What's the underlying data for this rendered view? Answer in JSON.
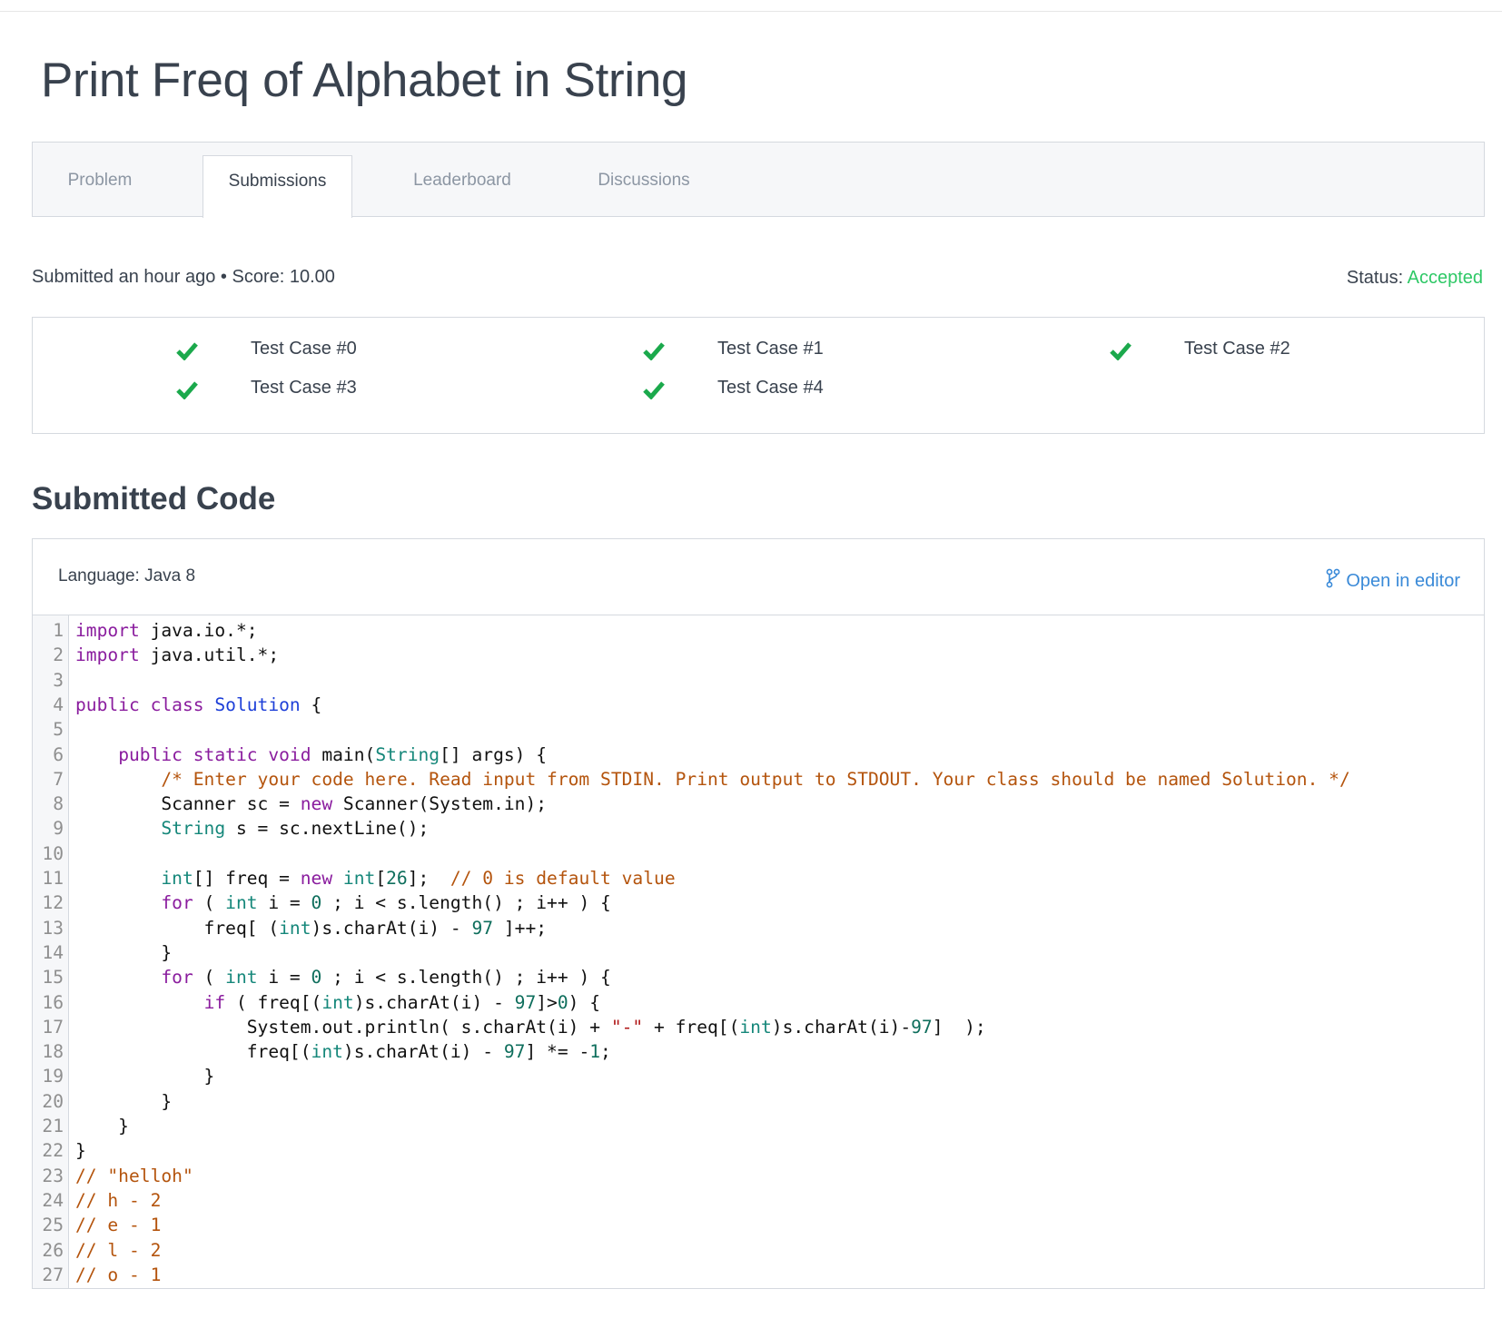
{
  "page": {
    "title": "Print Freq of Alphabet in String"
  },
  "tabs": [
    {
      "label": "Problem",
      "active": false
    },
    {
      "label": "Submissions",
      "active": true
    },
    {
      "label": "Leaderboard",
      "active": false
    },
    {
      "label": "Discussions",
      "active": false
    }
  ],
  "submission": {
    "info": "Submitted an hour ago • Score: 10.00",
    "status_label": "Status:",
    "status_value": "Accepted",
    "status_color": "#2ec866"
  },
  "test_cases": [
    {
      "label": "Test Case #0",
      "passed": true,
      "icon": "check-icon"
    },
    {
      "label": "Test Case #1",
      "passed": true,
      "icon": "check-icon"
    },
    {
      "label": "Test Case #2",
      "passed": true,
      "icon": "check-icon"
    },
    {
      "label": "Test Case #3",
      "passed": true,
      "icon": "check-icon"
    },
    {
      "label": "Test Case #4",
      "passed": true,
      "icon": "check-icon"
    }
  ],
  "code_section": {
    "title": "Submitted Code",
    "language": "Language: Java 8",
    "open_in_editor": "Open in editor",
    "open_icon": "git-branch-icon",
    "lines": [
      "import java.io.*;",
      "import java.util.*;",
      "",
      "public class Solution {",
      "",
      "    public static void main(String[] args) {",
      "        /* Enter your code here. Read input from STDIN. Print output to STDOUT. Your class should be named Solution. */",
      "        Scanner sc = new Scanner(System.in);",
      "        String s = sc.nextLine();",
      "",
      "        int[] freq = new int[26];  // 0 is default value",
      "        for ( int i = 0 ; i < s.length() ; i++ ) {",
      "            freq[ (int)s.charAt(i) - 97 ]++;",
      "        }",
      "        for ( int i = 0 ; i < s.length() ; i++ ) {",
      "            if ( freq[(int)s.charAt(i) - 97]>0) {",
      "                System.out.println( s.charAt(i) + \"-\" + freq[(int)s.charAt(i)-97]  );",
      "                freq[(int)s.charAt(i) - 97] *= -1;",
      "            }",
      "        }",
      "    }",
      "}",
      "// \"helloh\"",
      "// h - 2",
      "// e - 1",
      "// l - 2",
      "// o - 1"
    ]
  },
  "colors": {
    "text": "#39424e",
    "accepted": "#2ec866",
    "check": "#1ba94c",
    "link": "#3a8ad8",
    "syntax_keyword": "#8a1c9e",
    "syntax_type": "#15877a",
    "syntax_class": "#1d3fd8",
    "syntax_number": "#0e6e5c",
    "syntax_string": "#b11919",
    "syntax_comment": "#b4540d"
  }
}
